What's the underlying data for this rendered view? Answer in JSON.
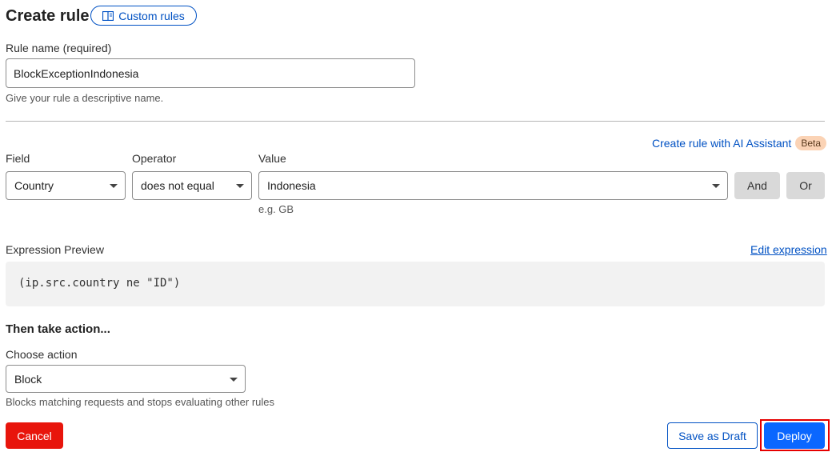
{
  "header": {
    "title": "Create rule",
    "custom_rules_label": "Custom rules"
  },
  "rule_name": {
    "label": "Rule name (required)",
    "value": "BlockExceptionIndonesia",
    "helper": "Give your rule a descriptive name."
  },
  "ai_assistant": {
    "link_label": "Create rule with AI Assistant",
    "badge": "Beta"
  },
  "condition": {
    "field_label": "Field",
    "field_value": "Country",
    "operator_label": "Operator",
    "operator_value": "does not equal",
    "value_label": "Value",
    "value_value": "Indonesia",
    "value_hint": "e.g. GB",
    "and_label": "And",
    "or_label": "Or"
  },
  "expression": {
    "label": "Expression Preview",
    "edit_label": "Edit expression",
    "preview": "(ip.src.country ne \"ID\")"
  },
  "action": {
    "section_title": "Then take action...",
    "label": "Choose action",
    "value": "Block",
    "helper": "Blocks matching requests and stops evaluating other rules"
  },
  "footer": {
    "cancel_label": "Cancel",
    "draft_label": "Save as Draft",
    "deploy_label": "Deploy"
  },
  "colors": {
    "link": "#0051c3",
    "cancel": "#e8150c",
    "deploy": "#0a67ff",
    "highlight_outline": "#e60000",
    "beta_badge": "#fbd3b5"
  }
}
